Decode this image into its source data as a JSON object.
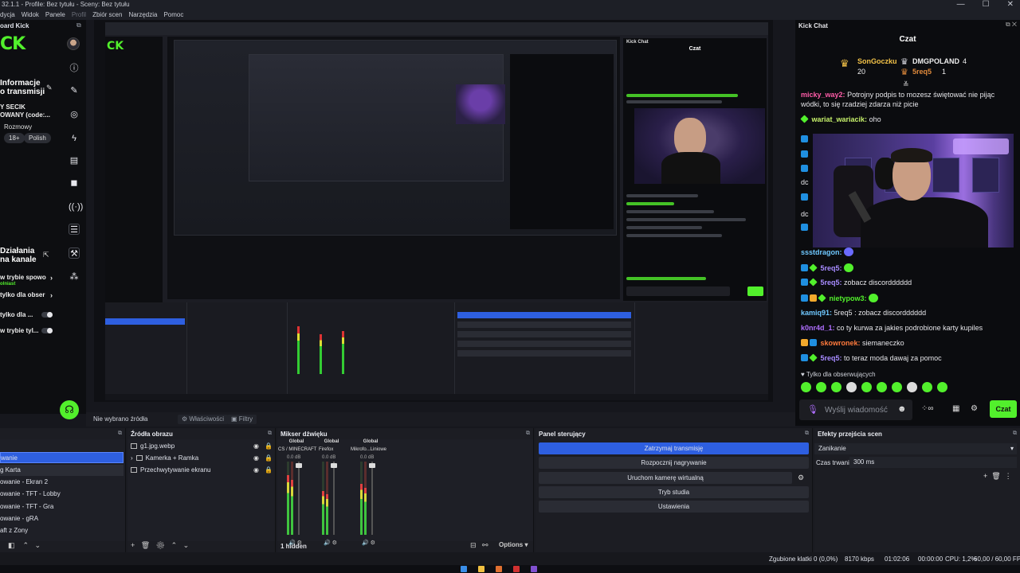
{
  "window": {
    "title": "32.1.1 - Profile: Bez tytułu - Sceny: Bez tytułu",
    "controls": [
      "—",
      "☐",
      "✕"
    ]
  },
  "menu": [
    "dycja",
    "Widok",
    "Panele",
    "Profil",
    "Zbiór scen",
    "Narzędzia",
    "Pomoc"
  ],
  "left_dock": {
    "title": "oard Kick",
    "logo": "CK",
    "info_title_1": "Informacje",
    "info_title_2": "o transmisji",
    "stream_title_1": "Y SECIK",
    "stream_title_2": "OWANY (code:...",
    "category": "Rozmowy",
    "tags": [
      "18+",
      "Polish"
    ],
    "actions_title_1": "Działania",
    "actions_title_2": "na kanale",
    "options": [
      {
        "label": "w trybie spowo",
        "sub": "olniast"
      },
      {
        "label": "tylko dla obser"
      },
      {
        "label": "tylko dla ..."
      },
      {
        "label": "w trybie tyl..."
      }
    ]
  },
  "chat": {
    "dock_title": "Kick Chat",
    "header": "Czat",
    "leaders": [
      {
        "name": "SonGoczku",
        "count": "20"
      },
      {
        "name": "DMGPOLAND",
        "count": "4"
      },
      {
        "name": "5req5",
        "count": "1"
      }
    ],
    "messages": [
      {
        "user": "micky_way2:",
        "text": "Potrojny podpis to mozesz świętować nie pijąc",
        "color": "#ff5ca8"
      },
      {
        "user": "",
        "text": "wódki, to się rzadziej zdarza niż picie",
        "color": "#ff5ca8"
      },
      {
        "user": "wariat_wariacik:",
        "text": "oho",
        "color": "#c7f26b"
      },
      {
        "user": "dc",
        "text": "",
        "color": "#e6e6ea"
      },
      {
        "user": "dc",
        "text": "",
        "color": "#e6e6ea"
      },
      {
        "user": "ssstdragon:",
        "text": "",
        "color": "#6fc8ff"
      },
      {
        "user": "5req5:",
        "text": "",
        "color": "#a78bff"
      },
      {
        "user": "5req5:",
        "text": "zobacz discordddddd",
        "color": "#a78bff"
      },
      {
        "user": "nietypow3:",
        "text": "",
        "color": "#52f02c"
      },
      {
        "user": "kamiq91:",
        "text": "5req5 : zobacz discordddddd",
        "color": "#6fc8ff"
      },
      {
        "user": "k0nr4d_1:",
        "text": "co ty kurwa za jakies podrobione karty kupiles",
        "color": "#b06fff"
      },
      {
        "user": "skowronek:",
        "text": "siemaneczko",
        "color": "#ff7a3c"
      },
      {
        "user": "5req5:",
        "text": "to teraz moda dawaj za pomoc",
        "color": "#a78bff"
      }
    ],
    "follow_note": "Tylko dla obserwujących",
    "input_placeholder": "Wyślij wiadomość",
    "send_label": "Czat",
    "brand_color": "#52f02c"
  },
  "preview_strip": {
    "no_source": "Nie wybrano źródła",
    "properties": "Właściwości",
    "filters": "Filtry"
  },
  "scenes": {
    "title": "",
    "items": [
      "wanie",
      "g Karta",
      "owanie - Ekran 2",
      "owanie - TFT - Lobby",
      "owanie - TFT - Gra",
      "owanie - gRA",
      "aft z Zony"
    ],
    "selected_index": 0
  },
  "sources": {
    "title": "Źródła obrazu",
    "items": [
      "g1.jpg.webp",
      "Kamerka + Ramka",
      "Przechwytywanie ekranu"
    ]
  },
  "mixer": {
    "title": "Mikser dźwięku",
    "channels": [
      {
        "global": "Global",
        "name": "CS / MINECRAFT",
        "db": "0.0 dB",
        "level": 0.82
      },
      {
        "global": "Global",
        "name": "Firefox",
        "db": "0.0 dB",
        "level": 0.6
      },
      {
        "global": "Global",
        "name": "Mikrofo...Liniowe",
        "db": "0.0 dB",
        "level": 0.7
      }
    ],
    "hidden": "1 hidden",
    "options": "Options"
  },
  "controls": {
    "title": "Panel sterujący",
    "buttons": [
      "Zatrzymaj transmisję",
      "Rozpocznij nagrywanie",
      "Uruchom kamerę wirtualną",
      "Tryb studia",
      "Ustawienia"
    ]
  },
  "transitions": {
    "title": "Efekty przejścia scen",
    "selected": "Zanikanie",
    "duration_label": "Czas trwania",
    "duration_value": "300 ms"
  },
  "status": {
    "dropped": "Zgubione klatki 0 (0,0%)",
    "bitrate": "8170 kbps",
    "time": "01:02:06",
    "rec_time": "00:00:00",
    "cpu": "CPU: 1,2%",
    "fps": "60,00 / 60,00 FPS"
  }
}
